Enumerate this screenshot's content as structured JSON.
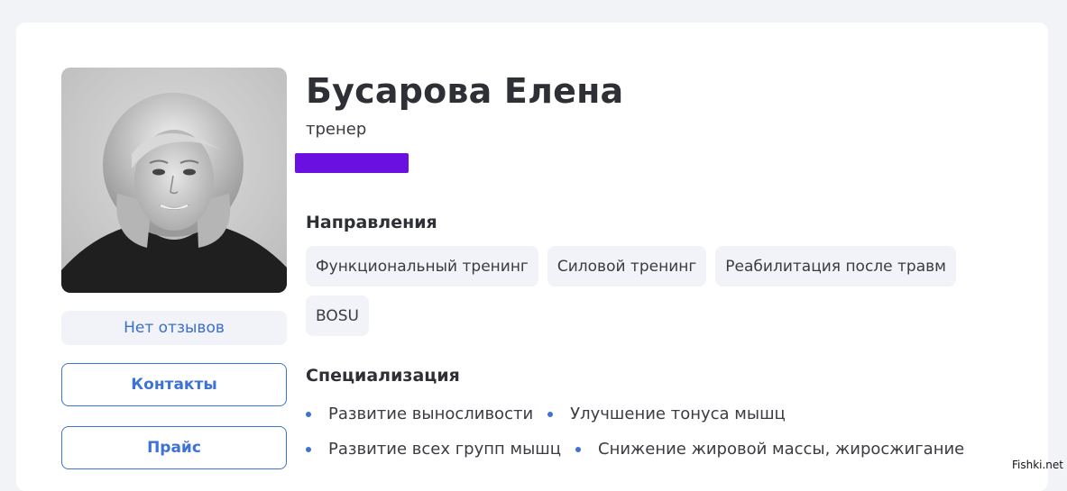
{
  "profile": {
    "name": "Бусарова Елена",
    "role": "тренер",
    "reviews": "Нет отзывов",
    "contacts_label": "Контакты",
    "price_label": "Прайс"
  },
  "directions": {
    "title": "Направления",
    "tags": [
      "Функциональный тренинг",
      "Силовой тренинг",
      "Реабилитация после травм",
      "BOSU"
    ]
  },
  "specialization": {
    "title": "Специализация",
    "rows": [
      [
        "Развитие выносливости",
        "Улучшение тонуса мышц"
      ],
      [
        "Развитие всех групп мышц",
        "Снижение жировой массы, жиросжигание"
      ]
    ]
  },
  "watermark": "Fishki.net",
  "colors": {
    "accent": "#3d72d6",
    "redaction": "#6a10e0",
    "tag_bg": "#f1f3f8"
  }
}
